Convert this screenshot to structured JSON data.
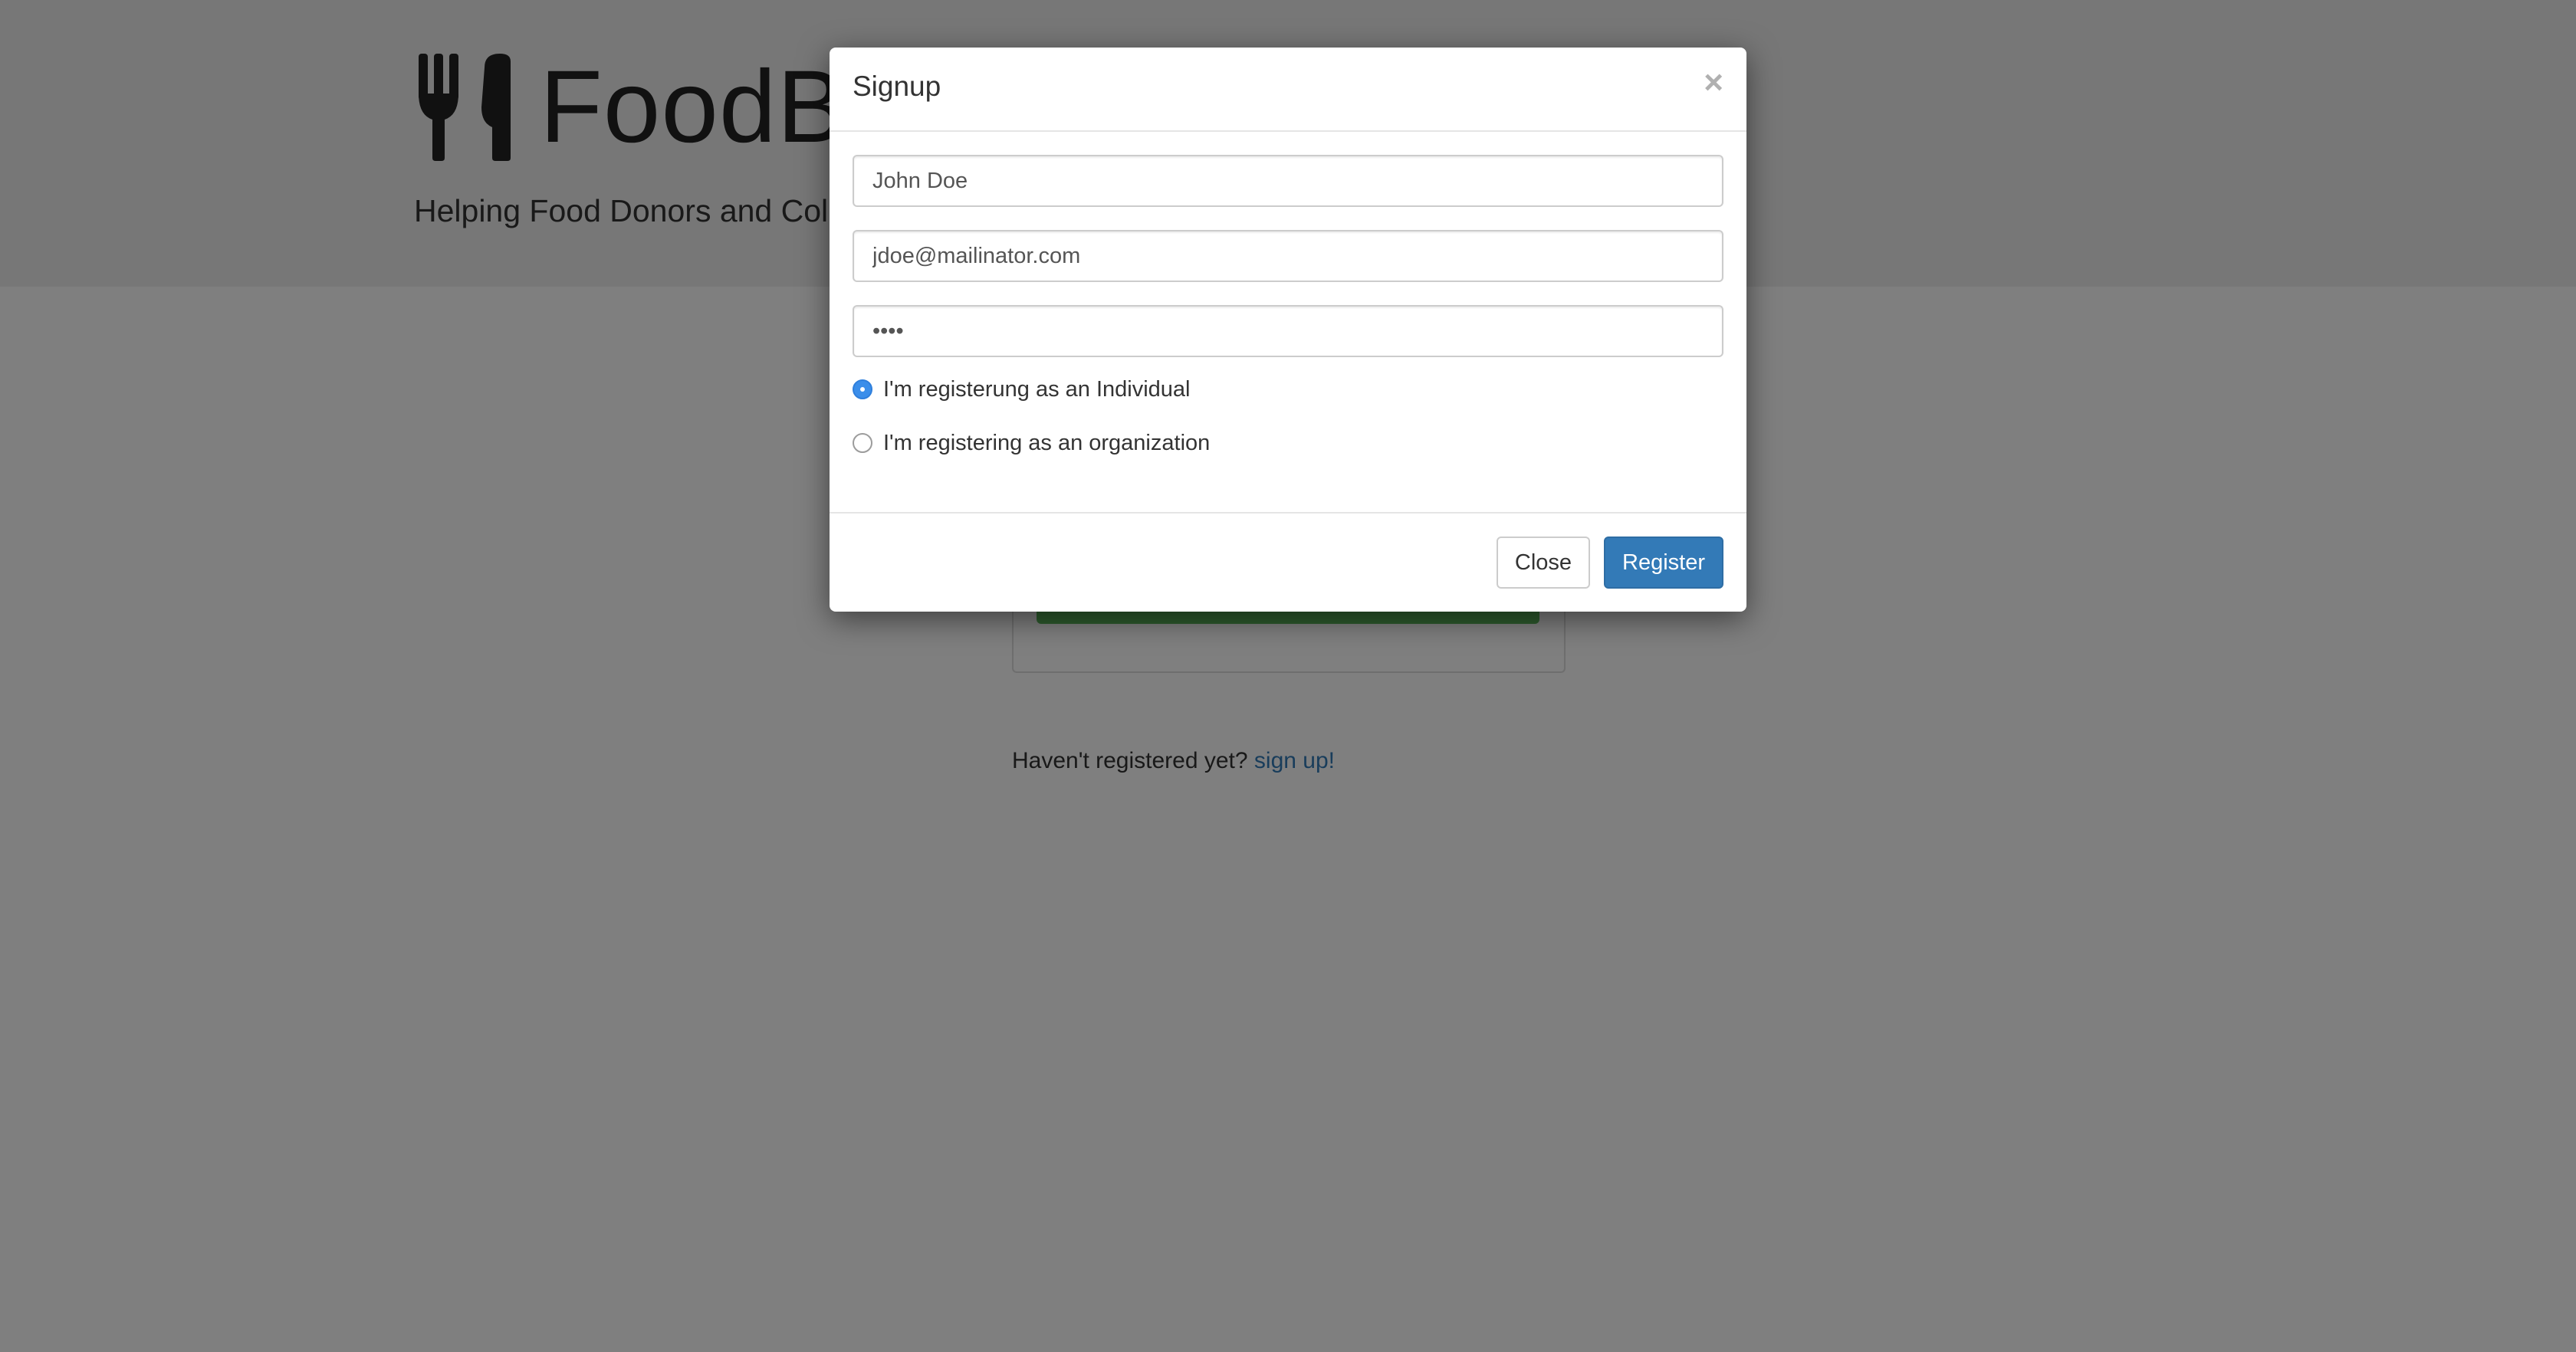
{
  "page": {
    "brand": "FoodB",
    "tagline": "Helping Food Donors and Coll",
    "signup_prompt": "Haven't registered yet?",
    "signup_link": "sign up!"
  },
  "modal": {
    "title": "Signup",
    "close_x": "×",
    "name_value": "John Doe",
    "email_value": "jdoe@mailinator.com",
    "password_value": "••••",
    "radio_individual_label": "I'm registerung as an Individual",
    "radio_individual_checked": true,
    "radio_organization_label": "I'm registering as an organization",
    "radio_organization_checked": false,
    "close_label": "Close",
    "register_label": "Register"
  },
  "icons": {
    "logo": "fork-knife-icon"
  },
  "colors": {
    "primary": "#337ab7",
    "success": "#5cb85c",
    "radio_checked": "#3b8eea"
  }
}
